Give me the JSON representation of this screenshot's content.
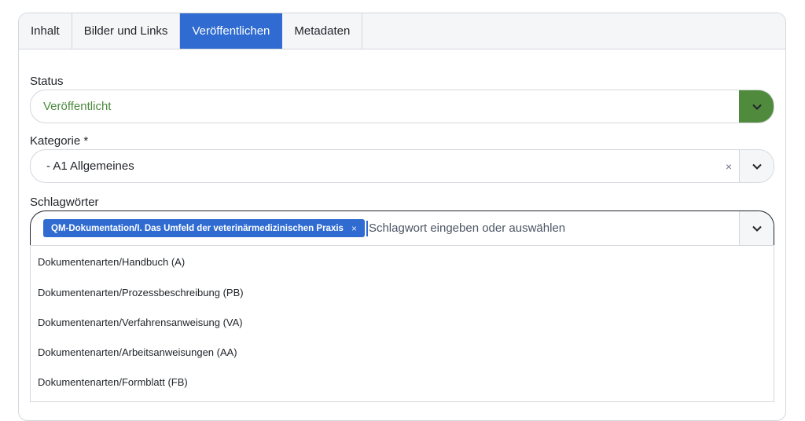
{
  "tabs": [
    {
      "label": "Inhalt"
    },
    {
      "label": "Bilder und Links"
    },
    {
      "label": "Veröffentlichen"
    },
    {
      "label": "Metadaten"
    }
  ],
  "status": {
    "label": "Status",
    "value": "Veröffentlicht"
  },
  "kategorie": {
    "label": "Kategorie *",
    "value": "- A1 Allgemeines",
    "clear": "×"
  },
  "schlagwoerter": {
    "label": "Schlagwörter",
    "chip": "QM-Dokumentation/I. Das Umfeld der veterinärmedizinischen Praxis",
    "chip_remove": "×",
    "placeholder": "Schlagwort eingeben oder auswählen",
    "options": [
      "Dokumentenarten/Handbuch (A)",
      "Dokumentenarten/Prozessbeschreibung (PB)",
      "Dokumentenarten/Verfahrensanweisung (VA)",
      "Dokumentenarten/Arbeitsanweisungen (AA)",
      "Dokumentenarten/Formblatt (FB)"
    ]
  },
  "colors": {
    "accent": "#2f6bd0",
    "status_green": "#4f8a3d"
  },
  "icons": [
    "chevron-down-icon",
    "close-icon"
  ]
}
